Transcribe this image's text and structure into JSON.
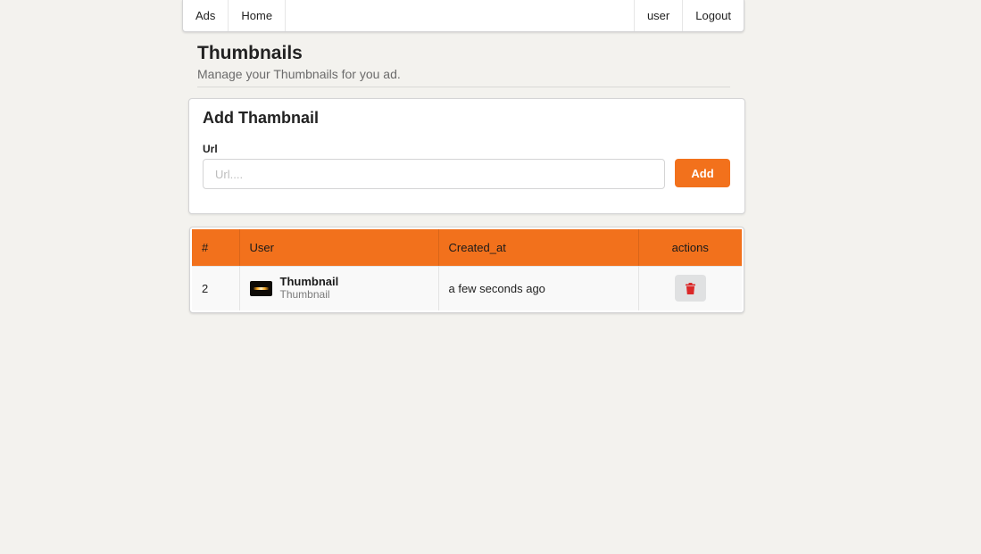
{
  "nav": {
    "ads": "Ads",
    "home": "Home",
    "user": "user",
    "logout": "Logout"
  },
  "header": {
    "title": "Thumbnails",
    "subtitle": "Manage your Thumbnails for you ad."
  },
  "form": {
    "title": "Add Thambnail",
    "url_label": "Url",
    "url_placeholder": "Url....",
    "url_value": "",
    "add_label": "Add"
  },
  "table": {
    "columns": [
      "#",
      "User",
      "Created_at",
      "actions"
    ],
    "rows": [
      {
        "id": "2",
        "name": "Thumbnail",
        "description": "Thumbnail",
        "created_at": "a few seconds ago",
        "action_icon": "trash-icon"
      }
    ]
  },
  "colors": {
    "accent": "#f2711c",
    "delete": "#db2828",
    "background": "#f3f2ee"
  }
}
